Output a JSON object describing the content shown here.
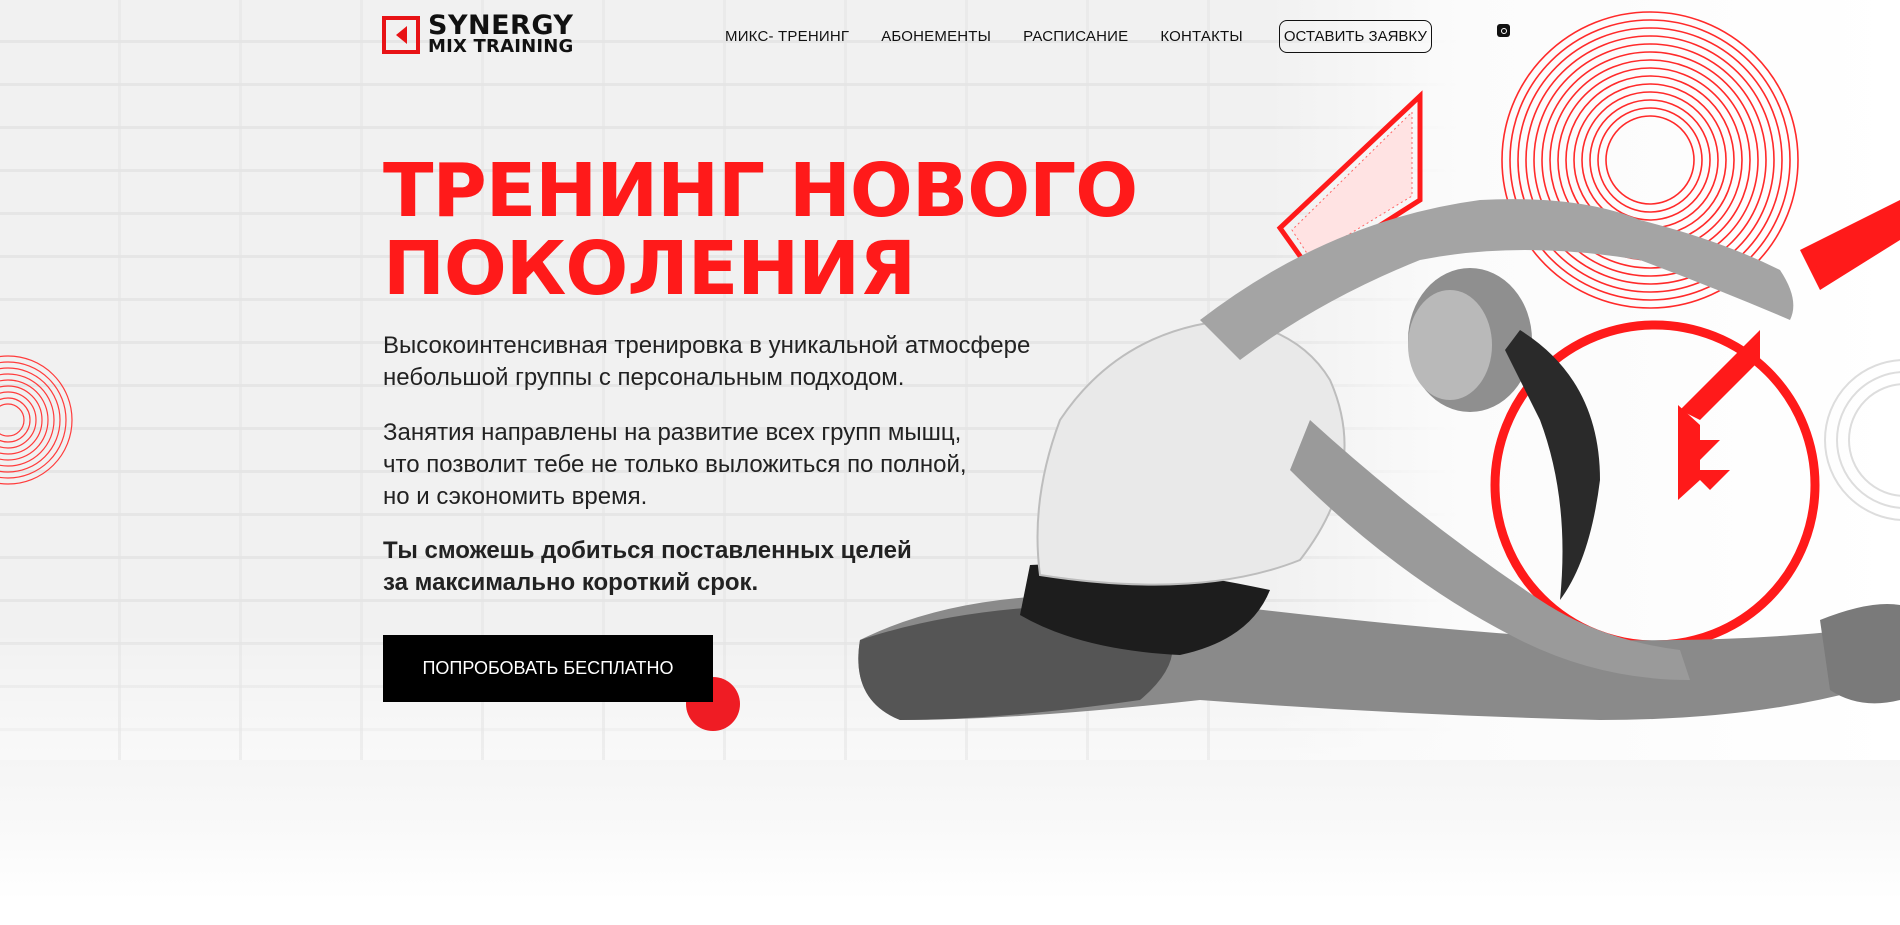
{
  "brand": {
    "line1": "SYNERGY",
    "line2": "MIX TRAINING"
  },
  "nav": {
    "items": [
      {
        "label": "МИКС- ТРЕНИНГ"
      },
      {
        "label": "АБОНЕМЕНТЫ"
      },
      {
        "label": "РАСПИСАНИЕ"
      },
      {
        "label": "КОНТАКТЫ"
      }
    ],
    "cta_label": "ОСТАВИТЬ ЗАЯВКУ",
    "social_icon": "instagram-icon"
  },
  "hero": {
    "title_line1": "ТРЕНИНГ НОВОГО",
    "title_line2": "ПОКОЛЕНИЯ",
    "p1_line1": "Высокоинтенсивная тренировка в уникальной атмосфере",
    "p1_line2": "небольшой группы с персональным подходом.",
    "p2_line1": "Занятия направлены на развитие всех групп мышц,",
    "p2_line2": "что позволит тебе не только выложиться по полной,",
    "p2_line3": "но и сэкономить время.",
    "p3_line1": "Ты сможешь добиться поставленных целей",
    "p3_line2": "за максимально короткий срок.",
    "cta_label": "ПОПРОБОВАТЬ БЕСПЛАТНО"
  },
  "colors": {
    "accent": "#ff1a1a",
    "dark": "#000000",
    "text": "#222222"
  }
}
